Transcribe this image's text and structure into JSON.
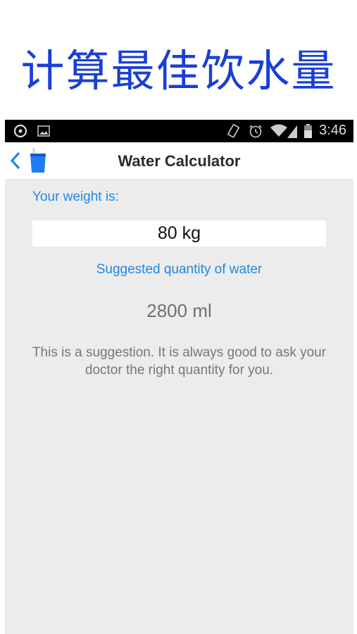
{
  "banner": {
    "text": "计算最佳饮水量",
    "color": "#1a3fd6"
  },
  "status_bar": {
    "time": "3:46",
    "left_icons": [
      "record-icon",
      "image-icon"
    ],
    "right_icons": [
      "rotate-icon",
      "alarm-icon",
      "wifi-icon",
      "signal-icon",
      "battery-icon"
    ]
  },
  "app_bar": {
    "title": "Water Calculator",
    "back_icon": "chevron-left-icon",
    "app_icon": "water-cup-icon",
    "accent": "#1e88e5"
  },
  "main": {
    "weight_label": "Your weight is:",
    "weight_value": "80 kg",
    "suggested_label": "Suggested quantity of water",
    "suggested_amount": "2800 ml",
    "disclaimer": "This is a suggestion. It is always good to ask your doctor the right quantity for you."
  }
}
